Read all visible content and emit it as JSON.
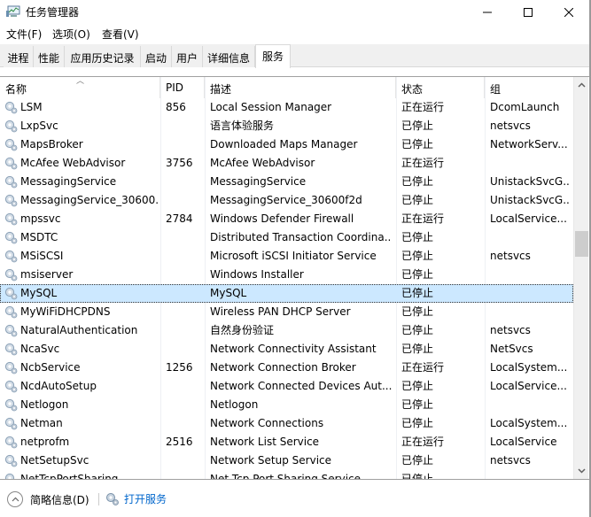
{
  "window": {
    "title": "任务管理器",
    "controls": {
      "minimize": "minimize",
      "maximize": "maximize",
      "close": "close"
    }
  },
  "menu": [
    {
      "label": "文件(F)"
    },
    {
      "label": "选项(O)"
    },
    {
      "label": "查看(V)"
    }
  ],
  "tabs": [
    {
      "label": "进程",
      "active": false
    },
    {
      "label": "性能",
      "active": false
    },
    {
      "label": "应用历史记录",
      "active": false
    },
    {
      "label": "启动",
      "active": false
    },
    {
      "label": "用户",
      "active": false
    },
    {
      "label": "详细信息",
      "active": false
    },
    {
      "label": "服务",
      "active": true
    }
  ],
  "table": {
    "columns": [
      {
        "key": "name",
        "label": "名称",
        "sorted": "ascending"
      },
      {
        "key": "pid",
        "label": "PID"
      },
      {
        "key": "desc",
        "label": "描述"
      },
      {
        "key": "status",
        "label": "状态"
      },
      {
        "key": "group",
        "label": "组"
      }
    ],
    "rows": [
      {
        "name": "LSM",
        "pid": "856",
        "desc": "Local Session Manager",
        "status": "正在运行",
        "group": "DcomLaunch"
      },
      {
        "name": "LxpSvc",
        "pid": "",
        "desc": "语言体验服务",
        "status": "已停止",
        "group": "netsvcs"
      },
      {
        "name": "MapsBroker",
        "pid": "",
        "desc": "Downloaded Maps Manager",
        "status": "已停止",
        "group": "NetworkServ..."
      },
      {
        "name": "McAfee WebAdvisor",
        "pid": "3756",
        "desc": "McAfee WebAdvisor",
        "status": "正在运行",
        "group": ""
      },
      {
        "name": "MessagingService",
        "pid": "",
        "desc": "MessagingService",
        "status": "已停止",
        "group": "UnistackSvcG..."
      },
      {
        "name": "MessagingService_30600...",
        "pid": "",
        "desc": "MessagingService_30600f2d",
        "status": "已停止",
        "group": "UnistackSvcG..."
      },
      {
        "name": "mpssvc",
        "pid": "2784",
        "desc": "Windows Defender Firewall",
        "status": "正在运行",
        "group": "LocalService..."
      },
      {
        "name": "MSDTC",
        "pid": "",
        "desc": "Distributed Transaction Coordina...",
        "status": "已停止",
        "group": ""
      },
      {
        "name": "MSiSCSI",
        "pid": "",
        "desc": "Microsoft iSCSI Initiator Service",
        "status": "已停止",
        "group": "netsvcs"
      },
      {
        "name": "msiserver",
        "pid": "",
        "desc": "Windows Installer",
        "status": "已停止",
        "group": ""
      },
      {
        "name": "MySQL",
        "pid": "",
        "desc": "MySQL",
        "status": "已停止",
        "group": "",
        "selected": true
      },
      {
        "name": "MyWiFiDHCPDNS",
        "pid": "",
        "desc": "Wireless PAN DHCP Server",
        "status": "已停止",
        "group": ""
      },
      {
        "name": "NaturalAuthentication",
        "pid": "",
        "desc": "自然身份验证",
        "status": "已停止",
        "group": "netsvcs"
      },
      {
        "name": "NcaSvc",
        "pid": "",
        "desc": "Network Connectivity Assistant",
        "status": "已停止",
        "group": "NetSvcs"
      },
      {
        "name": "NcbService",
        "pid": "1256",
        "desc": "Network Connection Broker",
        "status": "正在运行",
        "group": "LocalSystem..."
      },
      {
        "name": "NcdAutoSetup",
        "pid": "",
        "desc": "Network Connected Devices Aut...",
        "status": "已停止",
        "group": "LocalService..."
      },
      {
        "name": "Netlogon",
        "pid": "",
        "desc": "Netlogon",
        "status": "已停止",
        "group": ""
      },
      {
        "name": "Netman",
        "pid": "",
        "desc": "Network Connections",
        "status": "已停止",
        "group": "LocalSystem..."
      },
      {
        "name": "netprofm",
        "pid": "2516",
        "desc": "Network List Service",
        "status": "正在运行",
        "group": "LocalService"
      },
      {
        "name": "NetSetupSvc",
        "pid": "",
        "desc": "Network Setup Service",
        "status": "已停止",
        "group": "netsvcs"
      },
      {
        "name": "NetTcpPortSharing",
        "pid": "",
        "desc": "Net.Tcp Port Sharing Service",
        "status": "已停止",
        "group": ""
      }
    ]
  },
  "scrollbar": {
    "position_fraction": 0.4
  },
  "footer": {
    "fewer_details": "简略信息(D)",
    "open_services": "打开服务"
  },
  "colors": {
    "selection": "#cce8ff",
    "link": "#0066cc",
    "tab_bg": "#f0f0f0"
  }
}
